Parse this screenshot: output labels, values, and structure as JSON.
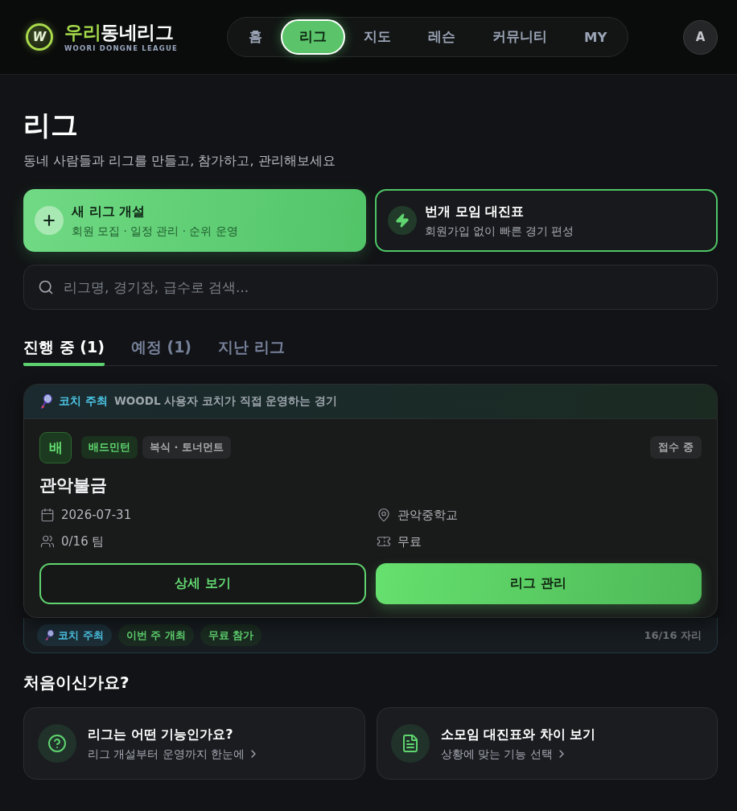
{
  "header": {
    "logo": {
      "mark": "W",
      "title_accent": "우리",
      "title_rest": "동네리그",
      "subtitle": "WOORI DONGNE LEAGUE"
    },
    "nav": [
      {
        "label": "홈",
        "selected": false
      },
      {
        "label": "리그",
        "selected": true
      },
      {
        "label": "지도",
        "selected": false
      },
      {
        "label": "레슨",
        "selected": false
      },
      {
        "label": "커뮤니티",
        "selected": false
      },
      {
        "label": "MY",
        "selected": false
      }
    ],
    "avatar": "A"
  },
  "page": {
    "title": "리그",
    "subtitle": "동네 사람들과 리그를 만들고, 참가하고, 관리해보세요"
  },
  "actions": [
    {
      "kind": "create",
      "title": "새 리그 개설",
      "subtitle": "회원 모집 · 일정 관리 · 순위 운영"
    },
    {
      "kind": "quick",
      "title": "번개 모임 대진표",
      "subtitle": "회원가입 없이 빠른 경기 편성"
    }
  ],
  "search": {
    "placeholder": "리그명, 경기장, 급수로 검색..."
  },
  "tabs": [
    {
      "label": "진행 중 (1)",
      "selected": true
    },
    {
      "label": "예정 (1)",
      "selected": false
    },
    {
      "label": "지난 리그",
      "selected": false
    }
  ],
  "league_card": {
    "banner": {
      "label": "코치 주최",
      "text": "WOODL 사용자 코치가 직접 운영하는 경기"
    },
    "sport_initial": "배",
    "tags": [
      {
        "kind": "sport",
        "label": "배드민턴"
      },
      {
        "kind": "format",
        "label": "복식 · 토너먼트"
      }
    ],
    "status": "접수 중",
    "title": "관악불금",
    "info": [
      {
        "kind": "date",
        "text": "2026-07-31"
      },
      {
        "kind": "location",
        "text": "관악중학교"
      },
      {
        "kind": "teams",
        "text": "0/16 팀"
      },
      {
        "kind": "fee",
        "text": "무료"
      }
    ],
    "buttons": [
      {
        "kind": "outline",
        "label": "상세 보기"
      },
      {
        "kind": "primary",
        "label": "리그 관리"
      }
    ],
    "footer": {
      "chips": [
        {
          "kind": "coach",
          "label": "코치 주최"
        },
        {
          "kind": "highlight",
          "label": "이번 주 개최"
        },
        {
          "kind": "highlight",
          "label": "무료 참가"
        }
      ],
      "slots": "16/16 자리"
    }
  },
  "help": {
    "title": "처음이신가요?",
    "cards": [
      {
        "kind": "question",
        "title": "리그는 어떤 기능인가요?",
        "subtitle": "리그 개설부터 운영까지 한눈에"
      },
      {
        "kind": "document",
        "title": "소모임 대진표와 차이 보기",
        "subtitle": "상황에 맞는 기능 선택"
      }
    ]
  }
}
